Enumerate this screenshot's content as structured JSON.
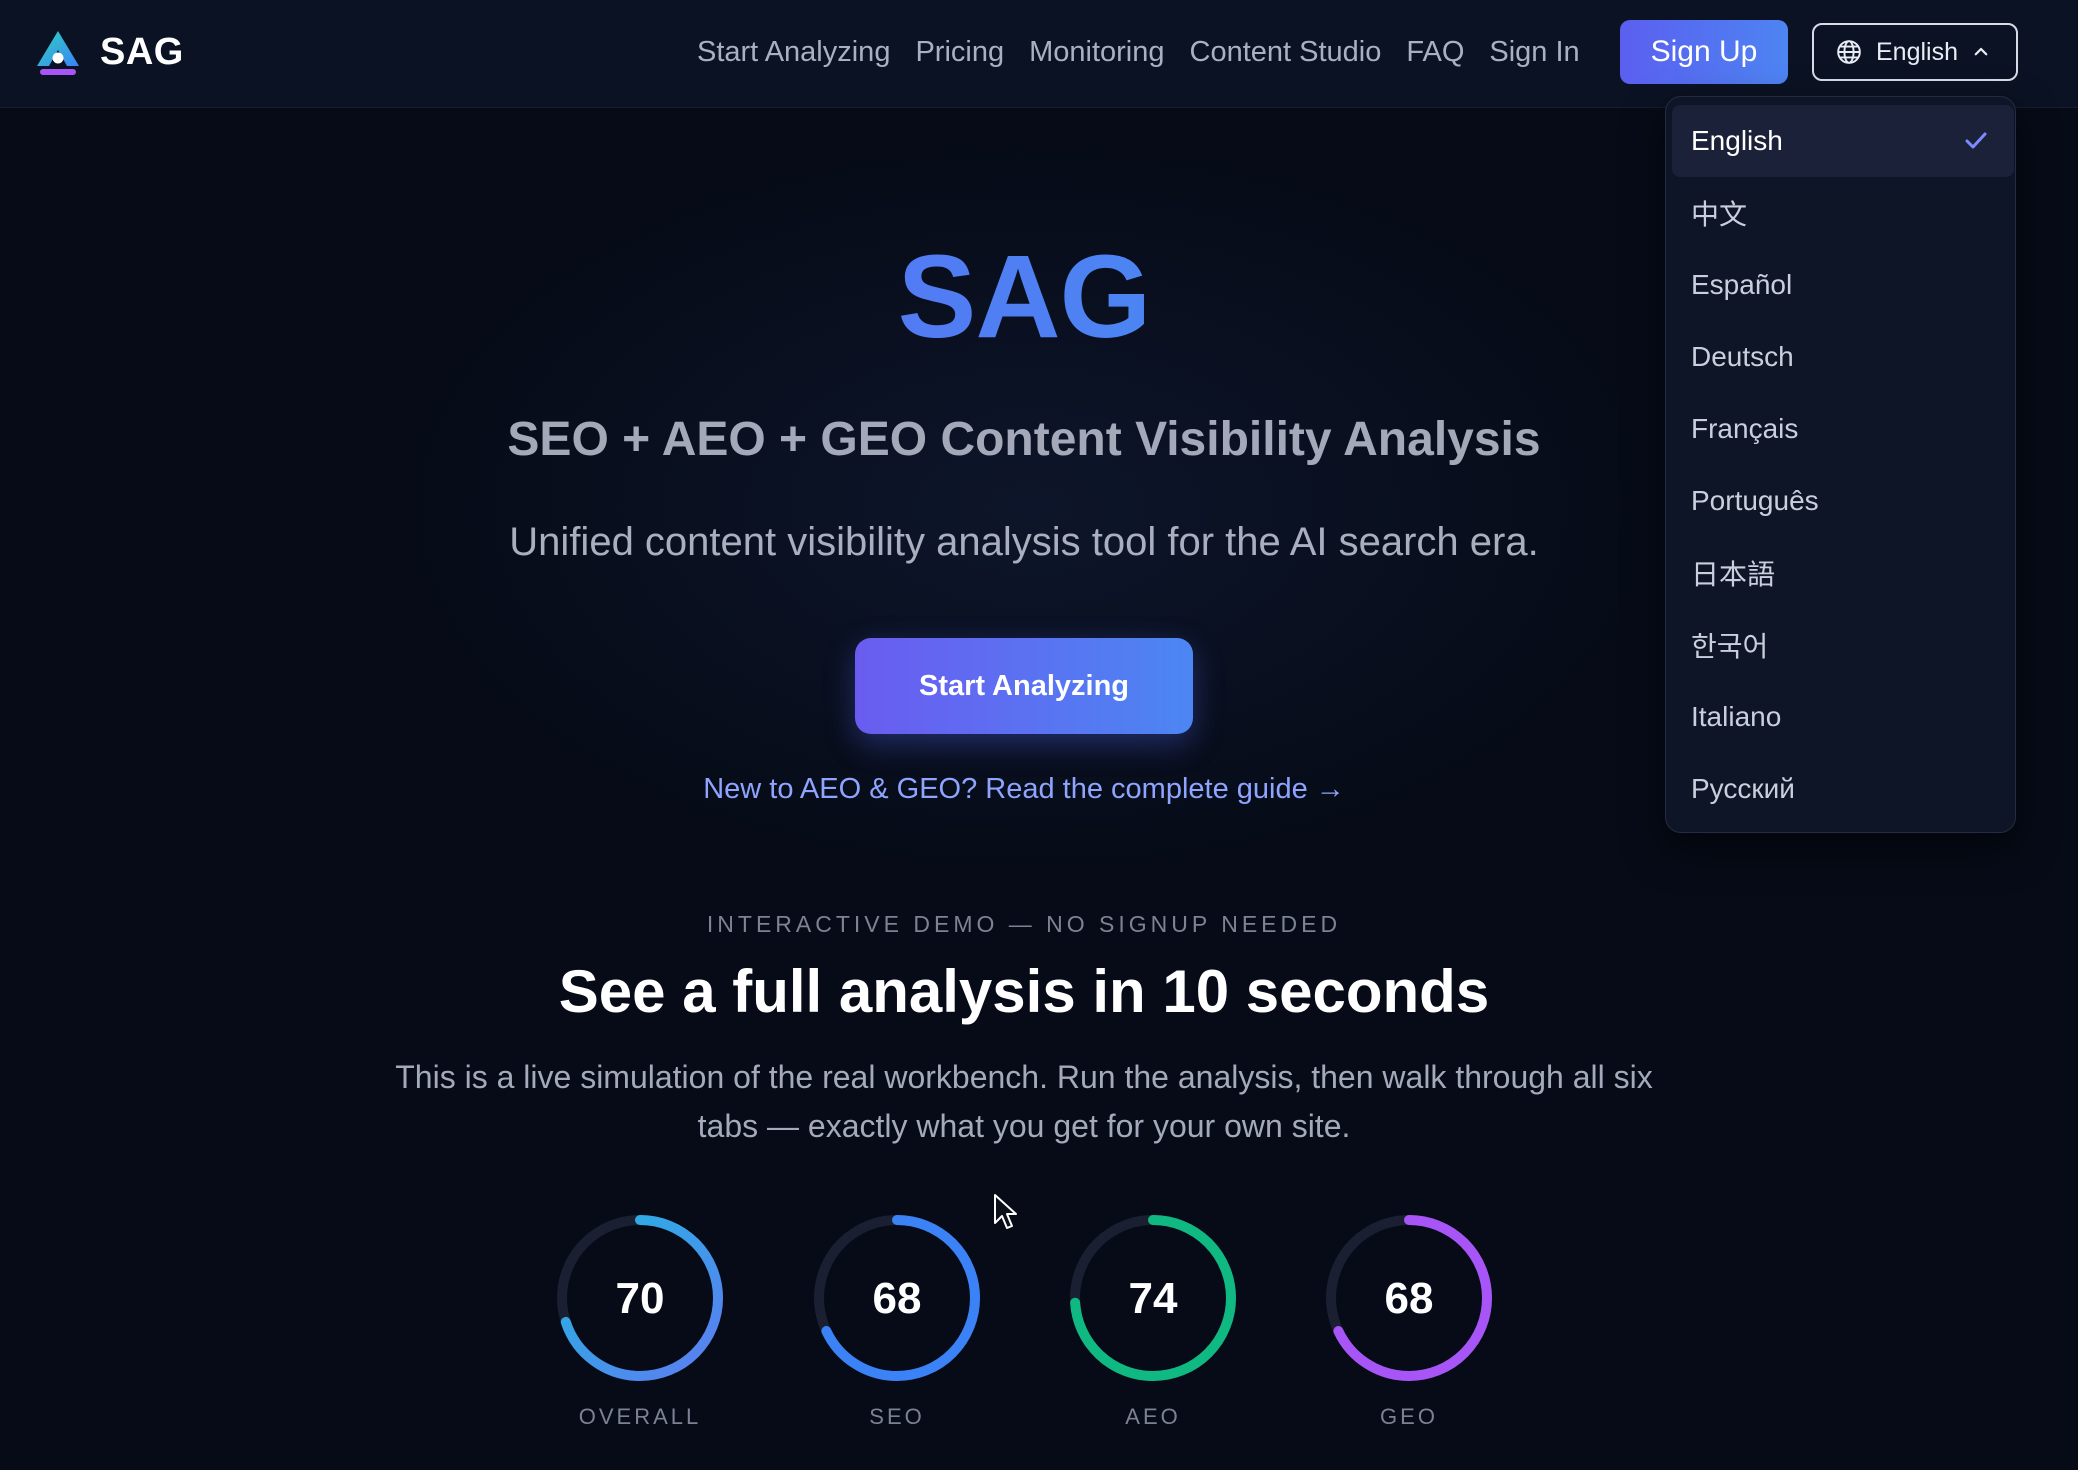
{
  "brand": {
    "name": "SAG"
  },
  "nav": {
    "links": [
      "Start Analyzing",
      "Pricing",
      "Monitoring",
      "Content Studio",
      "FAQ",
      "Sign In"
    ],
    "signup_label": "Sign Up",
    "language_label": "English",
    "language_icon": "globe-icon",
    "chevron_icon": "chevron-up-icon"
  },
  "language_menu": {
    "selected": "English",
    "items": [
      "English",
      "中文",
      "Español",
      "Deutsch",
      "Français",
      "Português",
      "日本語",
      "한국어",
      "Italiano",
      "Русский"
    ]
  },
  "hero": {
    "title": "SAG",
    "subtitle": "SEO + AEO + GEO Content Visibility Analysis",
    "description": "Unified content visibility analysis tool for the AI search era.",
    "cta_label": "Start Analyzing",
    "guide_link": "New to AEO & GEO? Read the complete guide →"
  },
  "demo": {
    "eyebrow": "INTERACTIVE DEMO — NO SIGNUP NEEDED",
    "title": "See a full analysis in 10 seconds",
    "description": "This is a live simulation of the real workbench. Run the analysis, then walk through all six tabs — exactly what you get for your own site."
  },
  "scores": [
    {
      "label": "OVERALL",
      "value": 70,
      "color_start": "#5d7cf2",
      "color_end": "#22b8e0"
    },
    {
      "label": "SEO",
      "value": 68,
      "color_start": "#3b82f6",
      "color_end": "#3b82f6"
    },
    {
      "label": "AEO",
      "value": 74,
      "color_start": "#10b981",
      "color_end": "#10b981"
    },
    {
      "label": "GEO",
      "value": 68,
      "color_start": "#a855f7",
      "color_end": "#a855f7"
    }
  ],
  "colors": {
    "background": "#060b17",
    "nav_background": "#0b1223",
    "accent": "#5b5ff0",
    "link": "#8ea4ff"
  }
}
